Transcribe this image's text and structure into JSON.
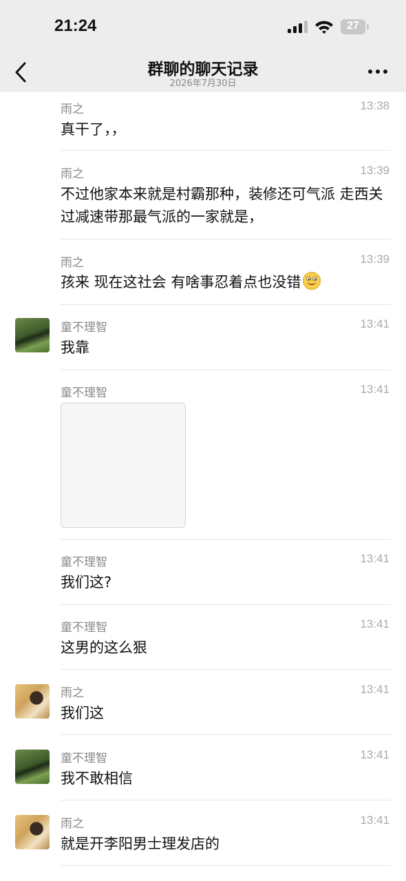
{
  "status_bar": {
    "time": "21:24",
    "battery": "27"
  },
  "header": {
    "title": "群聊的聊天记录",
    "subtitle": "2026年7月30日"
  },
  "messages": [
    {
      "sender": "雨之",
      "time": "13:38",
      "text": "真干了，，"
    },
    {
      "sender": "雨之",
      "time": "13:39",
      "text": "不过他家本来就是村霸那种，装修还可气派 走西关过减速带那最气派的一家就是，"
    },
    {
      "sender": "雨之",
      "time": "13:39",
      "text": "孩来 现在这社会 有啥事忍着点也没错",
      "emoji": "grinning-face-emoji"
    },
    {
      "sender": "童不理智",
      "time": "13:41",
      "text": "我靠"
    },
    {
      "sender": "童不理智",
      "time": "13:41",
      "image": "image-message"
    },
    {
      "sender": "童不理智",
      "time": "13:41",
      "text": "我们这?"
    },
    {
      "sender": "童不理智",
      "time": "13:41",
      "text": "这男的这么狠"
    },
    {
      "sender": "雨之",
      "time": "13:41",
      "text": "我们这"
    },
    {
      "sender": "童不理智",
      "time": "13:41",
      "text": "我不敢相信"
    },
    {
      "sender": "雨之",
      "time": "13:41",
      "text": "就是开李阳男士理发店的"
    }
  ],
  "colors": {
    "header_bg": "#ededed",
    "divider": "#e5e5e5",
    "sender_text": "#888888",
    "timestamp_text": "#aaaaaa"
  }
}
